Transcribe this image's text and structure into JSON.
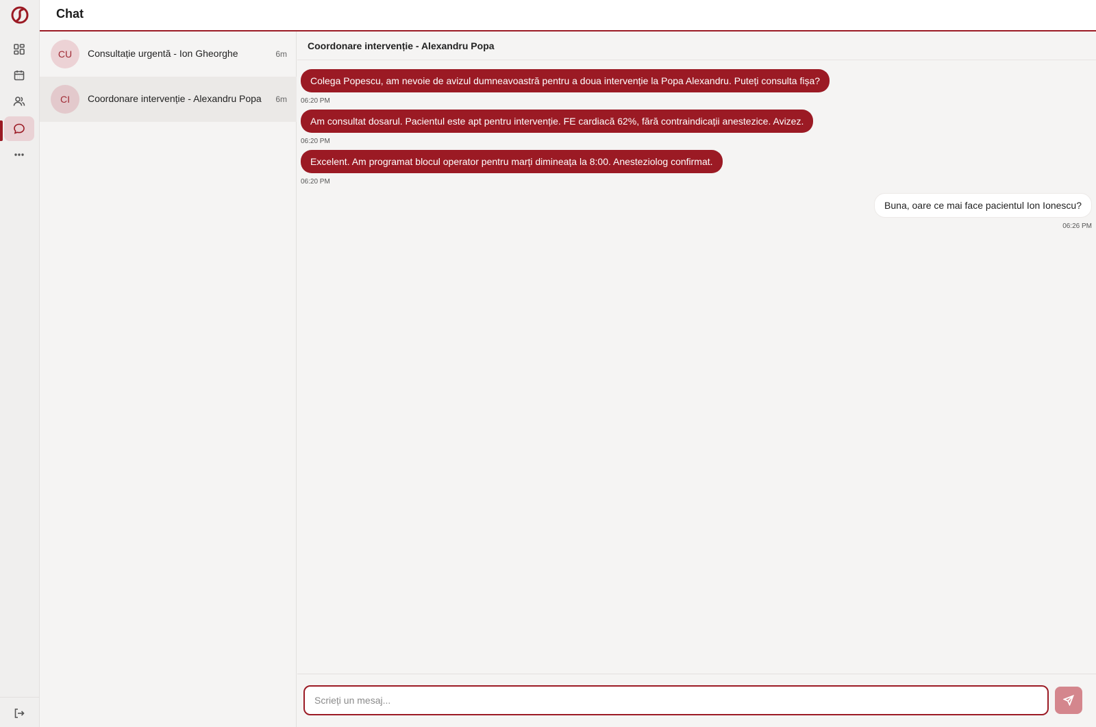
{
  "app": {
    "page_title": "Chat",
    "accent_color": "#9b1a24",
    "logo_icon": "app-logo-icon"
  },
  "nav": {
    "items": [
      {
        "name": "dashboard",
        "icon": "dashboard-icon",
        "active": false
      },
      {
        "name": "calendar",
        "icon": "calendar-icon",
        "active": false
      },
      {
        "name": "patients",
        "icon": "users-icon",
        "active": false
      },
      {
        "name": "chat",
        "icon": "chat-icon",
        "active": true
      },
      {
        "name": "more",
        "icon": "more-icon",
        "active": false
      }
    ],
    "logout_icon": "logout-icon"
  },
  "conversations": [
    {
      "initials": "CU",
      "title": "Consultație urgentă - Ion Gheorghe",
      "time": "6m",
      "selected": false
    },
    {
      "initials": "CI",
      "title": "Coordonare intervenție - Alexandru Popa",
      "time": "6m",
      "selected": true
    }
  ],
  "chat": {
    "title": "Coordonare intervenție - Alexandru Popa",
    "messages": [
      {
        "direction": "incoming",
        "text": "Colega Popescu, am nevoie de avizul dumneavoastră pentru a doua intervenție la Popa Alexandru. Puteți consulta fișa?",
        "time": "06:20 PM"
      },
      {
        "direction": "incoming",
        "text": "Am consultat dosarul. Pacientul este apt pentru intervenție. FE cardiacă 62%, fără contraindicații anestezice. Avizez.",
        "time": "06:20 PM"
      },
      {
        "direction": "incoming",
        "text": "Excelent. Am programat blocul operator pentru marți dimineața la 8:00. Anesteziolog confirmat.",
        "time": "06:20 PM"
      },
      {
        "direction": "outgoing",
        "text": "Buna, oare ce mai face pacientul Ion Ionescu?",
        "time": "06:26 PM"
      }
    ]
  },
  "composer": {
    "value": "",
    "placeholder": "Scrieți un mesaj...",
    "send_icon": "send-icon"
  }
}
